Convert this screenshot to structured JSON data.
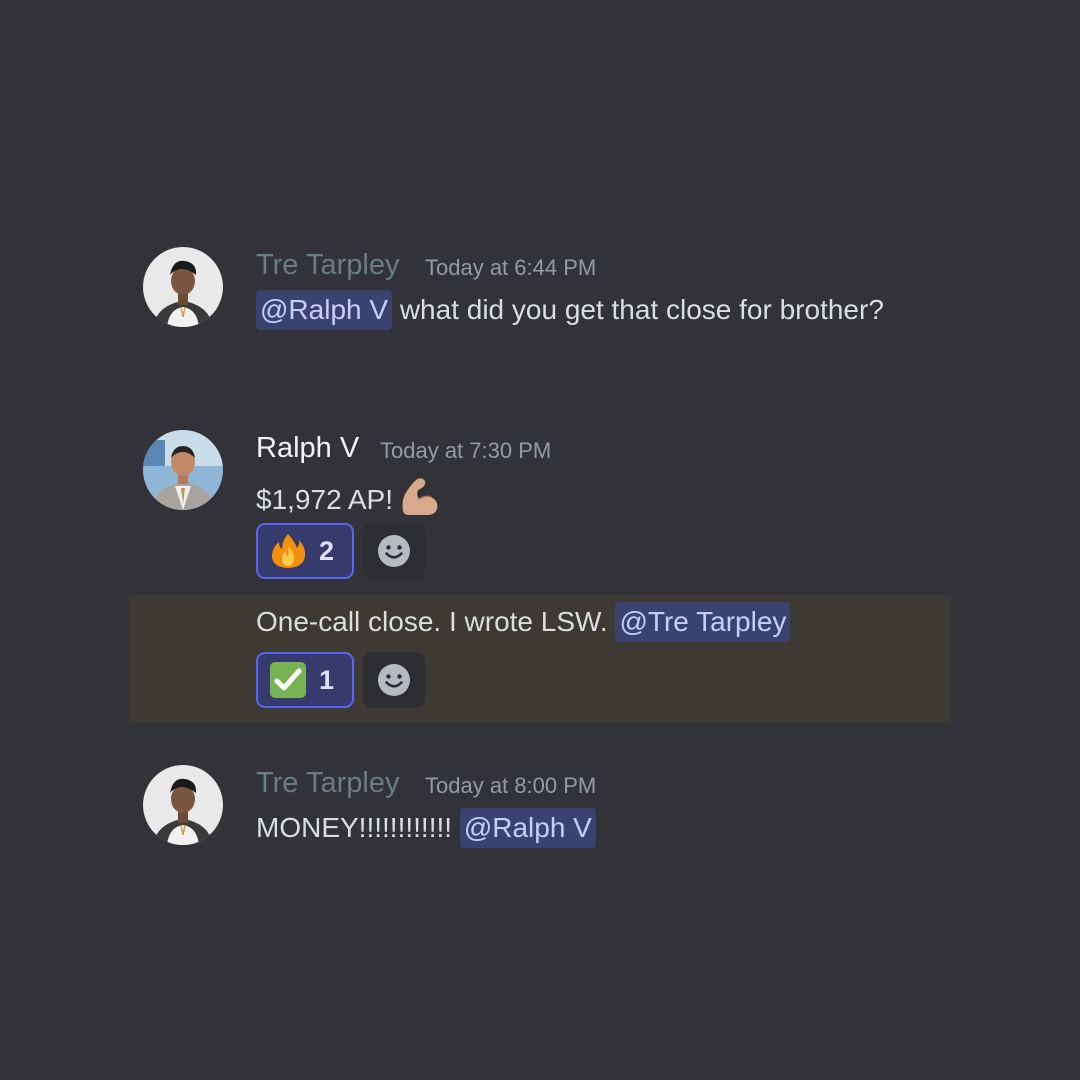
{
  "messages": [
    {
      "author": "Tre Tarpley",
      "timestamp": "Today at 6:44 PM",
      "mention": "@Ralph V",
      "text": "what did you get that close for brother?"
    },
    {
      "author": "Ralph V",
      "timestamp": "Today at 7:30 PM",
      "text": "$1,972 AP!",
      "inline_emoji": "flexed-biceps-icon",
      "reaction": {
        "emoji": "fire-icon",
        "count": "2"
      }
    },
    {
      "text": "One-call close. I wrote LSW.",
      "mention": "@Tre Tarpley",
      "reaction": {
        "emoji": "check-mark-icon",
        "count": "1"
      }
    },
    {
      "author": "Tre Tarpley",
      "timestamp": "Today at 8:00 PM",
      "text": "MONEY!!!!!!!!!!!!",
      "mention": "@Ralph V"
    }
  ],
  "colors": {
    "background": "#313338",
    "highlight": "#3d3a33",
    "mention_bg": "#3c4270",
    "mention_text": "#c9cdfb",
    "reaction_border": "#5865f2"
  }
}
